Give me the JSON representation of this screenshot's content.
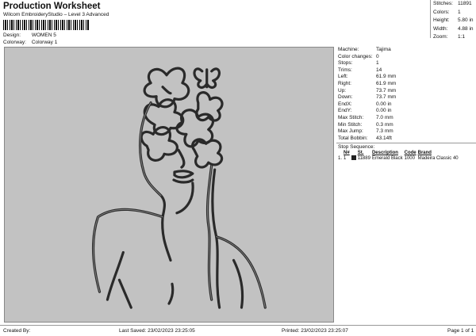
{
  "header": {
    "title": "Production Worksheet",
    "subtitle": "Wilcom EmbroideryStudio – Level 3 Advanced",
    "design_label": "Design:",
    "design_value": "WOMEN 5",
    "colorway_label": "Colorway:",
    "colorway_value": "Colorway 1"
  },
  "stats": [
    {
      "label": "Stitches:",
      "value": "11891"
    },
    {
      "label": "Colors:",
      "value": "1"
    },
    {
      "label": "Height:",
      "value": "5.80 in"
    },
    {
      "label": "Width:",
      "value": "4.88 in"
    },
    {
      "label": "Zoom:",
      "value": "1:1"
    }
  ],
  "info": [
    {
      "label": "Machine:",
      "value": "Tajima"
    },
    {
      "label": "Color changes:",
      "value": "0"
    },
    {
      "label": "Stops:",
      "value": "1"
    },
    {
      "label": "Trims:",
      "value": "14"
    },
    {
      "label": "Left:",
      "value": "61.9 mm"
    },
    {
      "label": "Right:",
      "value": "61.9 mm"
    },
    {
      "label": "Up:",
      "value": "73.7 mm"
    },
    {
      "label": "Down:",
      "value": "73.7 mm"
    },
    {
      "label": "EndX:",
      "value": "0.00 in"
    },
    {
      "label": "EndY:",
      "value": "0.00 in"
    },
    {
      "label": "Max Stitch:",
      "value": "7.0 mm"
    },
    {
      "label": "Min Stitch:",
      "value": "0.3 mm"
    },
    {
      "label": "Max Jump:",
      "value": "7.3 mm"
    },
    {
      "label": "Total Bobbin:",
      "value": "43.14ft"
    }
  ],
  "stop_sequence": {
    "title": "Stop Sequence:",
    "headers": [
      "N#",
      "St.",
      "Description",
      "Code",
      "Brand"
    ],
    "rows": [
      {
        "index": "1.",
        "n": "1",
        "stitches": "11889",
        "description": "Emerald Black",
        "code": "1000",
        "brand": "Madeira Classic 40",
        "color": "#222222"
      }
    ]
  },
  "footer": {
    "created_by": "Created By:",
    "last_saved": "Last Saved: 23/02/2023 23:25:05",
    "printed": "Printed: 23/02/2023 23:25:07",
    "page": "Page 1 of 1"
  },
  "colors": {
    "canvas": "#c2c2c2",
    "thread": "#2a2a2a",
    "thread_inner": "#8c8c8c"
  }
}
